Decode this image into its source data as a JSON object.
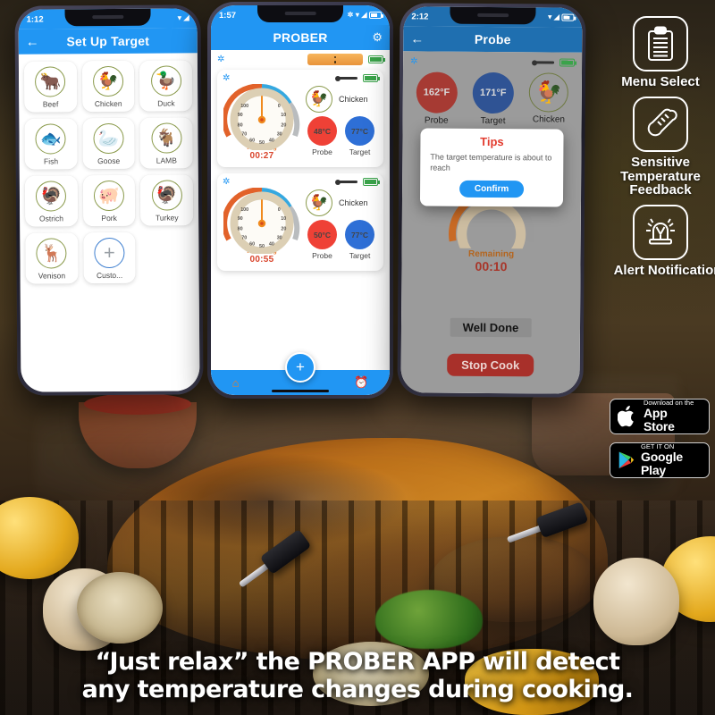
{
  "phone1": {
    "status_time": "1:12",
    "status_icons": [
      "wifi-icon",
      "signal-icon"
    ],
    "appbar": {
      "back": "←",
      "title": "Set Up Target"
    },
    "meats": [
      {
        "label": "Beef",
        "icon": "🐂",
        "icon_name": "beef-icon",
        "color": "#d1462f"
      },
      {
        "label": "Chicken",
        "icon": "🐓",
        "icon_name": "chicken-icon",
        "color": "#ef7f2e"
      },
      {
        "label": "Duck",
        "icon": "🦆",
        "icon_name": "duck-icon",
        "color": "#4f9b2f"
      },
      {
        "label": "Fish",
        "icon": "🐟",
        "icon_name": "fish-icon",
        "color": "#1f7fd0"
      },
      {
        "label": "Goose",
        "icon": "🦢",
        "icon_name": "goose-icon",
        "color": "#2bc4cc"
      },
      {
        "label": "LAMB",
        "icon": "🐐",
        "icon_name": "lamb-icon",
        "color": "#e8bf3a"
      },
      {
        "label": "Ostrich",
        "icon": "🦃",
        "icon_name": "ostrich-icon",
        "color": "#b8b02c"
      },
      {
        "label": "Pork",
        "icon": "🐖",
        "icon_name": "pork-icon",
        "color": "#ef6a62"
      },
      {
        "label": "Turkey",
        "icon": "🦃",
        "icon_name": "turkey-icon",
        "color": "#e0396e"
      },
      {
        "label": "Venison",
        "icon": "🦌",
        "icon_name": "venison-icon",
        "color": "#d1722a"
      },
      {
        "label": "Custo...",
        "icon": "+",
        "icon_name": "add-custom-icon",
        "color": "#9aa0a6"
      }
    ]
  },
  "phone2": {
    "status_time": "1:57",
    "appbar": {
      "title": "PROBER",
      "gear": "⚙"
    },
    "device_bar_name": "probe-device-strip",
    "cards": [
      {
        "gauge": {
          "min": 0,
          "max": 100,
          "value": 50,
          "ticks": [
            0,
            10,
            20,
            30,
            40,
            50,
            60,
            70,
            80,
            90,
            100
          ]
        },
        "remaining_label": "Remaining",
        "remaining_time": "00:27",
        "meat": "Chicken",
        "meat_icon": "🐓",
        "probe_temp": "48°C",
        "target_temp": "77°C",
        "probe_label": "Probe",
        "target_label": "Target"
      },
      {
        "gauge": {
          "min": 0,
          "max": 100,
          "value": 50,
          "ticks": [
            0,
            10,
            20,
            30,
            40,
            50,
            60,
            70,
            80,
            90,
            100
          ]
        },
        "remaining_label": "Remaining",
        "remaining_time": "00:55",
        "meat": "Chicken",
        "meat_icon": "🐓",
        "probe_temp": "50°C",
        "target_temp": "77°C",
        "probe_label": "Probe",
        "target_label": "Target"
      }
    ],
    "tabbar": {
      "home_icon": "⌂",
      "add_icon": "+",
      "alarm_icon": "⏰"
    }
  },
  "phone3": {
    "status_time": "2:12",
    "appbar": {
      "back": "←",
      "title": "Probe"
    },
    "probe_temp": "162°F",
    "target_temp": "171°F",
    "probe_label": "Probe",
    "target_label": "Target",
    "meat": "Chicken",
    "meat_icon": "🐓",
    "dialog": {
      "title": "Tips",
      "message": "The target temperature is about to reach",
      "confirm": "Confirm"
    },
    "remaining_label": "Remaining",
    "remaining_time": "00:10",
    "doneness": "Well Done",
    "stop_button": "Stop Cook"
  },
  "features": [
    {
      "label": "Menu Select",
      "icon_name": "clipboard-icon"
    },
    {
      "label": "Sensitive Temperature Feedback",
      "icon_name": "thermometer-icon"
    },
    {
      "label": "Alert Notification",
      "icon_name": "siren-icon"
    }
  ],
  "stores": [
    {
      "small": "Download on the",
      "big": "App Store",
      "icon_name": "apple-logo-icon"
    },
    {
      "small": "GET IT ON",
      "big": "Google Play",
      "icon_name": "google-play-icon"
    }
  ],
  "tagline": {
    "line1": "“Just relax” the PROBER APP will detect",
    "line2": "any temperature changes during cooking."
  },
  "colors": {
    "brand_blue": "#2196f3",
    "probe_red": "#ef4136",
    "target_blue": "#2e6fd6",
    "accent_orange": "#e8762a",
    "stop_red": "#a8302a",
    "tips_red": "#e23b2e"
  }
}
